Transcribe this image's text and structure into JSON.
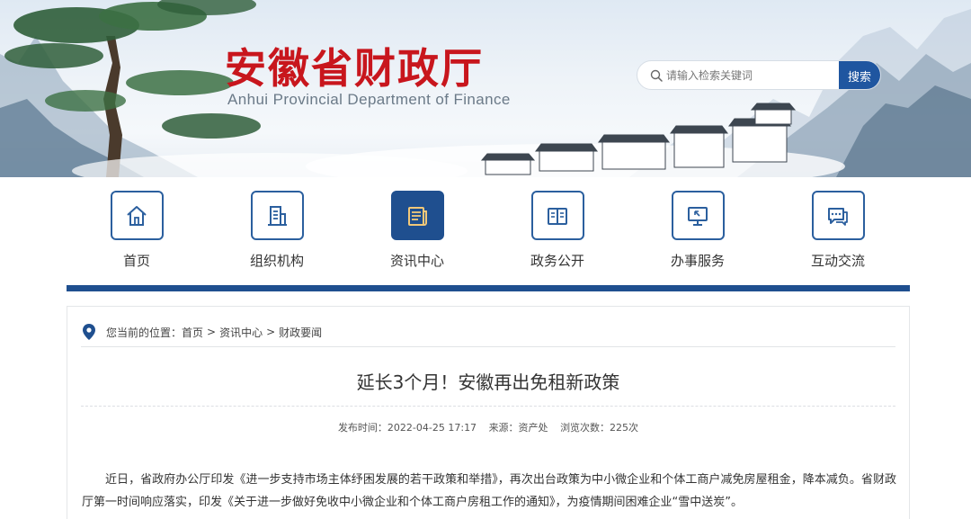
{
  "header": {
    "title": "安徽省财政厅",
    "subtitle": "Anhui Provincial Department of Finance",
    "search": {
      "placeholder": "请输入检索关键词",
      "button_label": "搜索"
    }
  },
  "nav": {
    "active": "资讯中心",
    "items": [
      {
        "label": "首页",
        "icon": "home-icon"
      },
      {
        "label": "组织机构",
        "icon": "building-icon"
      },
      {
        "label": "资讯中心",
        "icon": "news-icon"
      },
      {
        "label": "政务公开",
        "icon": "book-icon"
      },
      {
        "label": "办事服务",
        "icon": "monitor-icon"
      },
      {
        "label": "互动交流",
        "icon": "chat-icon"
      }
    ]
  },
  "breadcrumb": {
    "prefix": "您当前的位置：",
    "items": [
      "首页",
      "资讯中心",
      "财政要闻"
    ],
    "separator": ">"
  },
  "article": {
    "title": "延长3个月！安徽再出免租新政策",
    "meta": {
      "publish_time": "发布时间：2022-04-25 17:17",
      "source": "来源：资产处",
      "views": "浏览次数：225次"
    },
    "body": "近日，省政府办公厅印发《进一步支持市场主体纾困发展的若干政策和举措》，再次出台政策为中小微企业和个体工商户减免房屋租金，降本减负。省财政厅第一时间响应落实，印发《关于进一步做好免收中小微企业和个体工商户房租工作的通知》，为疫情期间困难企业“雪中送炭”。"
  },
  "colors": {
    "brand_red": "#c8161d",
    "nav_blue": "#1f4f8f",
    "search_blue": "#1f56a0"
  }
}
